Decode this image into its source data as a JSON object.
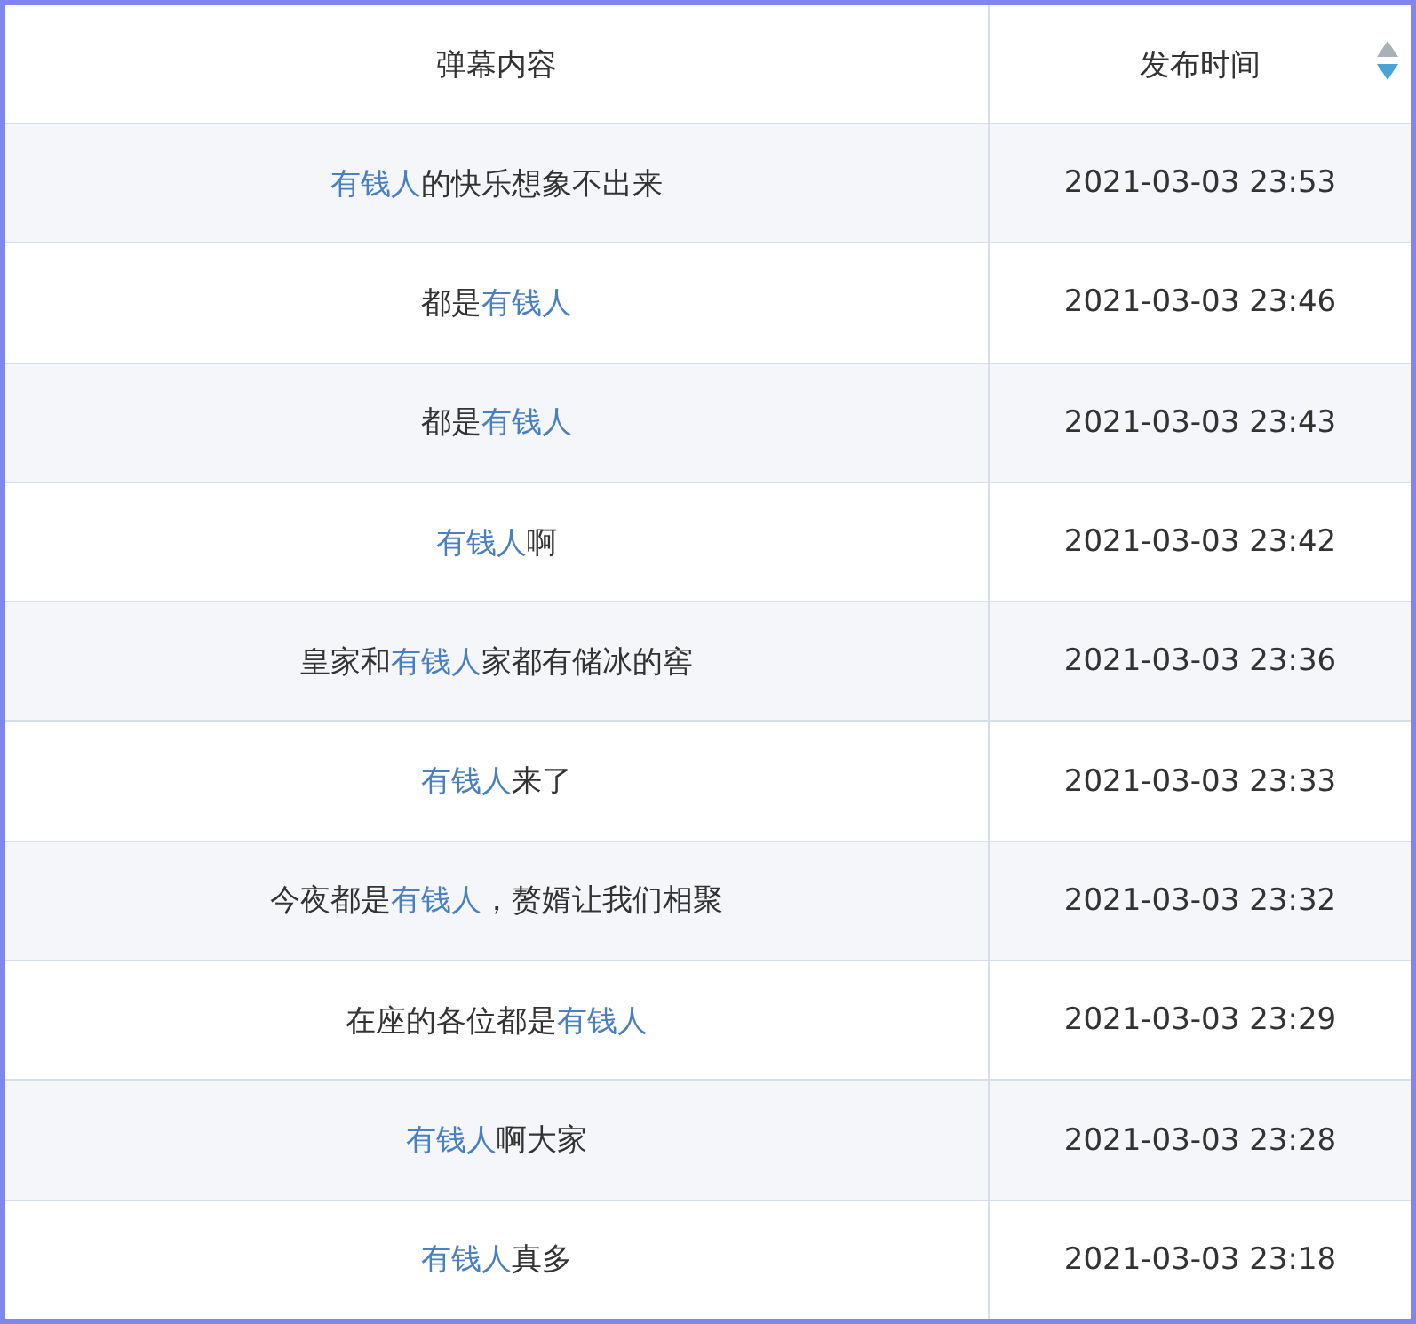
{
  "table": {
    "columns": [
      {
        "label": "弹幕内容"
      },
      {
        "label": "发布时间",
        "sorted": true,
        "descending": true
      }
    ],
    "rows": [
      {
        "content": [
          {
            "text": "有钱人",
            "highlight": true
          },
          {
            "text": "的快乐想象不出来",
            "highlight": false
          }
        ],
        "time": "2021-03-03 23:53"
      },
      {
        "content": [
          {
            "text": "都是",
            "highlight": false
          },
          {
            "text": "有钱人",
            "highlight": true
          }
        ],
        "time": "2021-03-03 23:46"
      },
      {
        "content": [
          {
            "text": "都是",
            "highlight": false
          },
          {
            "text": "有钱人",
            "highlight": true
          }
        ],
        "time": "2021-03-03 23:43"
      },
      {
        "content": [
          {
            "text": "有钱人",
            "highlight": true
          },
          {
            "text": "啊",
            "highlight": false
          }
        ],
        "time": "2021-03-03 23:42"
      },
      {
        "content": [
          {
            "text": "皇家和",
            "highlight": false
          },
          {
            "text": "有钱人",
            "highlight": true
          },
          {
            "text": "家都有储冰的窖",
            "highlight": false
          }
        ],
        "time": "2021-03-03 23:36"
      },
      {
        "content": [
          {
            "text": "有钱人",
            "highlight": true
          },
          {
            "text": "来了",
            "highlight": false
          }
        ],
        "time": "2021-03-03 23:33"
      },
      {
        "content": [
          {
            "text": "今夜都是",
            "highlight": false
          },
          {
            "text": "有钱人",
            "highlight": true
          },
          {
            "text": "，赘婿让我们相聚",
            "highlight": false
          }
        ],
        "time": "2021-03-03 23:32"
      },
      {
        "content": [
          {
            "text": "在座的各位都是",
            "highlight": false
          },
          {
            "text": "有钱人",
            "highlight": true
          }
        ],
        "time": "2021-03-03 23:29"
      },
      {
        "content": [
          {
            "text": "有钱人",
            "highlight": true
          },
          {
            "text": "啊大家",
            "highlight": false
          }
        ],
        "time": "2021-03-03 23:28"
      },
      {
        "content": [
          {
            "text": "有钱人",
            "highlight": true
          },
          {
            "text": "真多",
            "highlight": false
          }
        ],
        "time": "2021-03-03 23:18"
      }
    ]
  }
}
